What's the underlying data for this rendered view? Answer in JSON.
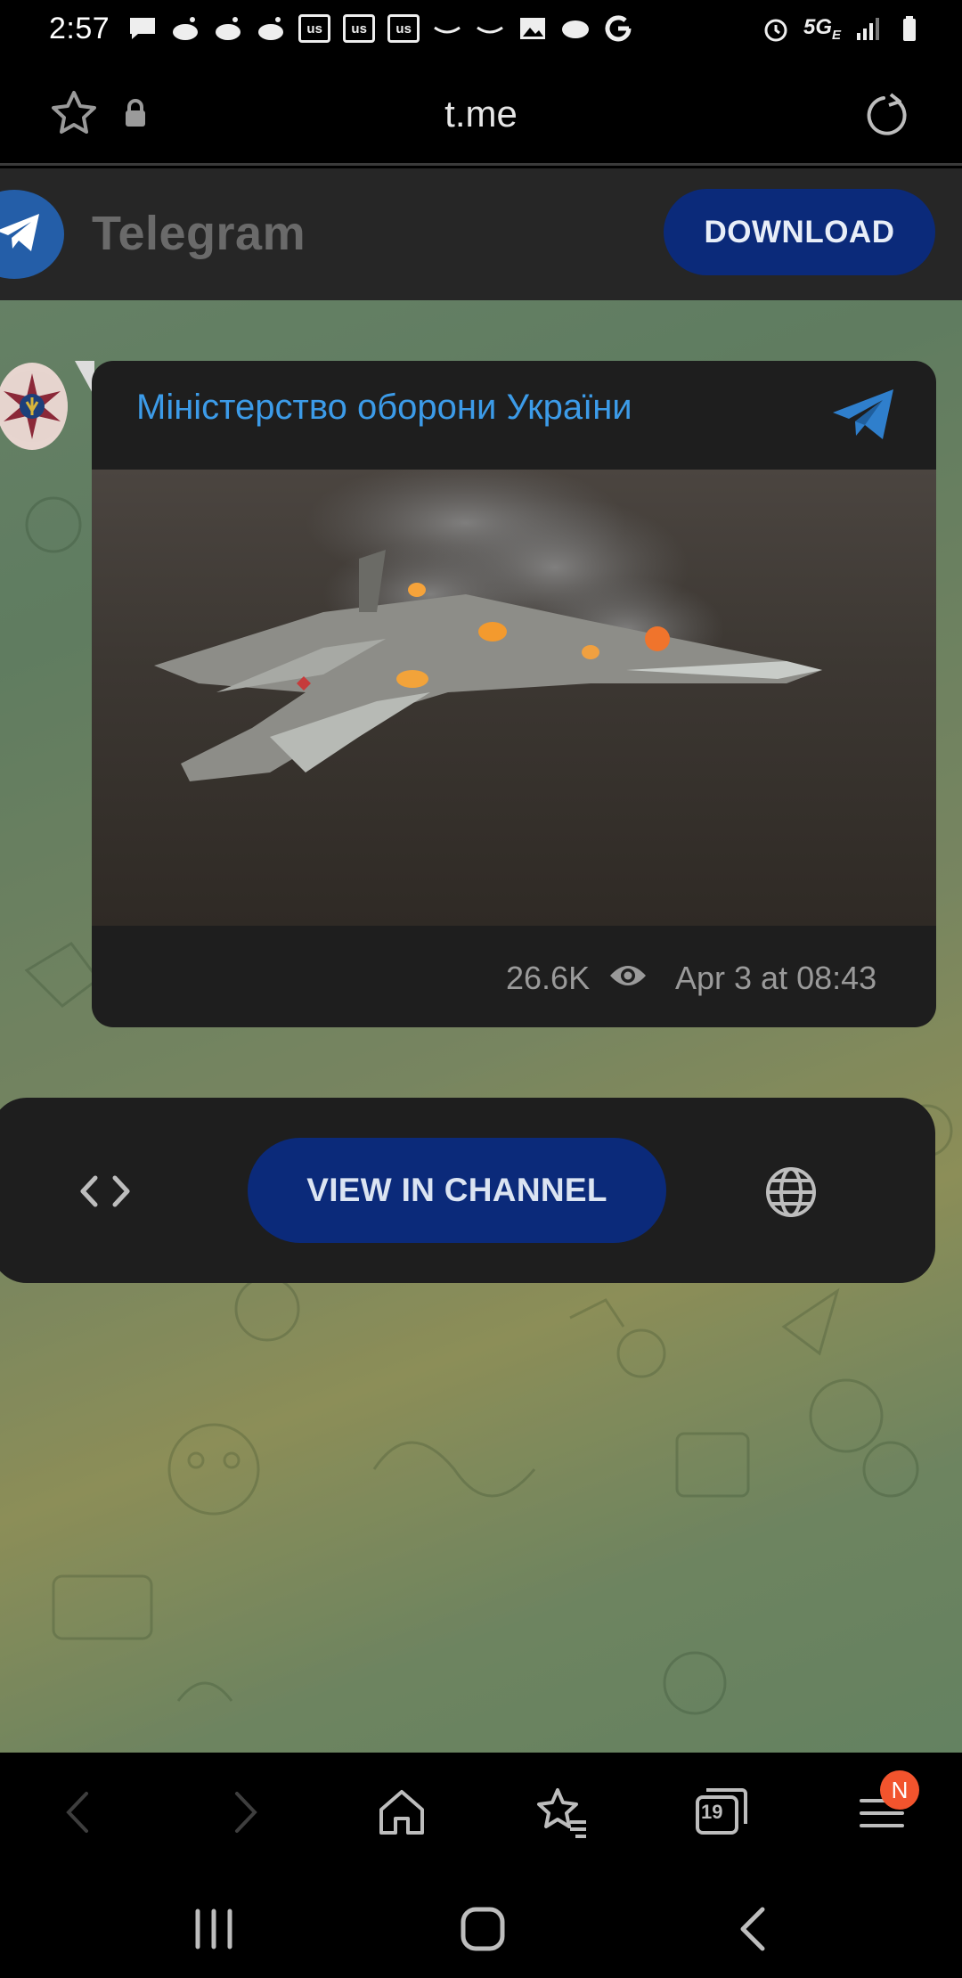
{
  "status_bar": {
    "time": "2:57",
    "notif_badges": [
      "us",
      "us",
      "us"
    ],
    "network": "5G",
    "network_sub": "E"
  },
  "browser": {
    "url": "t.me"
  },
  "telegram": {
    "brand": "Telegram",
    "download_label": "DOWNLOAD"
  },
  "message": {
    "channel_name": "Міністерство оборони України",
    "views": "26.6K",
    "date": "Apr 3 at 08:43"
  },
  "actions": {
    "view_in_channel_label": "VIEW IN CHANNEL"
  },
  "bottom_nav": {
    "tabs_count": "19",
    "menu_badge": "N"
  },
  "colors": {
    "accent_blue": "#3c9be8",
    "button_dark_blue": "#0b2a7a",
    "badge_orange": "#f2542d"
  }
}
